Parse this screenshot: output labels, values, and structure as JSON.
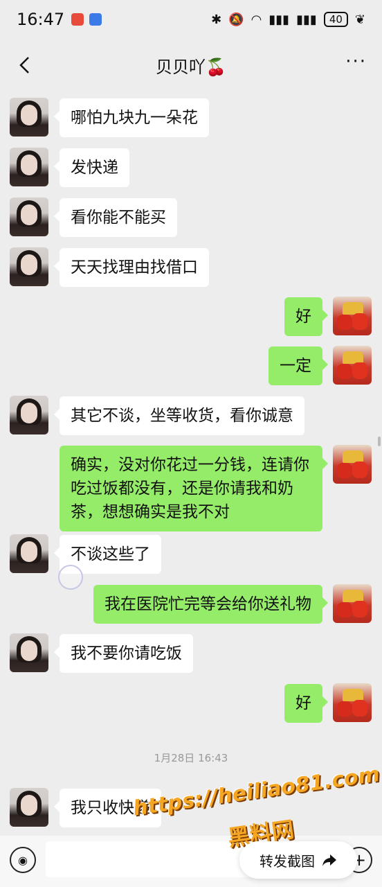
{
  "status": {
    "time": "16:47",
    "battery": "40",
    "app_icon_1_color": "#e84b3c",
    "app_icon_2_color": "#3b7be8"
  },
  "nav": {
    "title": "贝贝吖🍒",
    "more": "···"
  },
  "messages": [
    {
      "side": "left",
      "text": "哪怕九块九一朵花"
    },
    {
      "side": "left",
      "text": "发快递"
    },
    {
      "side": "left",
      "text": "看你能不能买"
    },
    {
      "side": "left",
      "text": "天天找理由找借口"
    },
    {
      "side": "right",
      "text": "好"
    },
    {
      "side": "right",
      "text": "一定"
    },
    {
      "side": "left",
      "text": "其它不谈，坐等收货，看你诚意"
    },
    {
      "side": "right",
      "text": "确实，没对你花过一分钱，连请你吃过饭都没有，还是你请我和奶茶，想想确实是我不对"
    },
    {
      "side": "left",
      "text": "不谈这些了"
    },
    {
      "side": "right",
      "text": "我在医院忙完等会给你送礼物"
    },
    {
      "side": "left",
      "text": "我不要你请吃饭"
    },
    {
      "side": "right",
      "text": "好"
    },
    {
      "side": "left",
      "text": "我只收快递"
    }
  ],
  "timestamp": "1月28日 16:43",
  "forward_button": {
    "label": "转发截图"
  },
  "watermark": {
    "url": "https://heiliao81.com",
    "name": "黑料网"
  },
  "colors": {
    "background": "#ededed",
    "bubble_self": "#95ec69",
    "bubble_other": "#ffffff"
  }
}
